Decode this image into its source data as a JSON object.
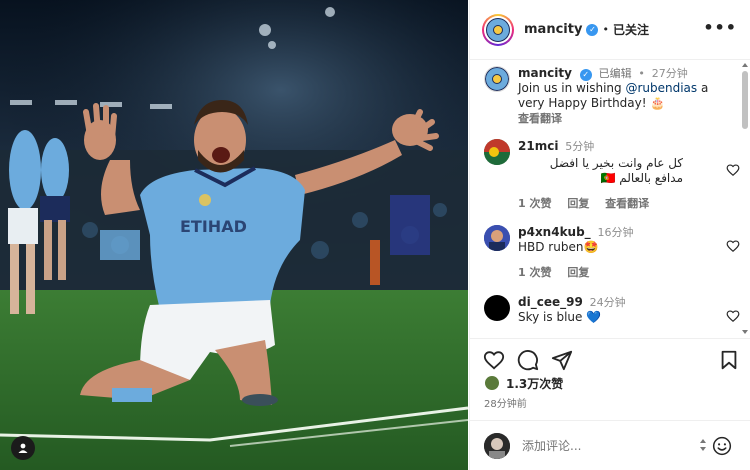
{
  "post": {
    "username": "mancity",
    "follow_status": "已关注",
    "more": "•••",
    "dot": "•"
  },
  "caption": {
    "username": "mancity",
    "edited": "已编辑",
    "time": "27分钟",
    "text_before": "Join us in wishing ",
    "mention": "@rubendias",
    "text_after": " a very Happy Birthday! 🎂",
    "translate": "查看翻译"
  },
  "comments": [
    {
      "username": "21mci",
      "time": "5分钟",
      "text": "كل عام وانت بخير يا افضل مدافع بالعالم 🇵🇹",
      "likes": "1 次赞",
      "reply": "回复",
      "translate": "查看翻译"
    },
    {
      "username": "p4xn4kub_",
      "time": "16分钟",
      "text": "HBD ruben🤩",
      "likes": "1 次赞",
      "reply": "回复"
    },
    {
      "username": "di_cee_99",
      "time": "24分钟",
      "text": "Sky is blue 💙"
    }
  ],
  "stats": {
    "likes": "1.3万次赞",
    "posted": "28分钟前"
  },
  "composer": {
    "placeholder": "添加评论..."
  },
  "icons": {
    "heart": "heart-icon",
    "comment": "comment-icon",
    "share": "send-icon",
    "save": "bookmark-icon",
    "emoji": "emoji-icon",
    "user": "user-tag-icon"
  },
  "colors": {
    "verified": "#3897f0",
    "jersey": "#6cabdd",
    "pitch": "#2f6b2c"
  }
}
